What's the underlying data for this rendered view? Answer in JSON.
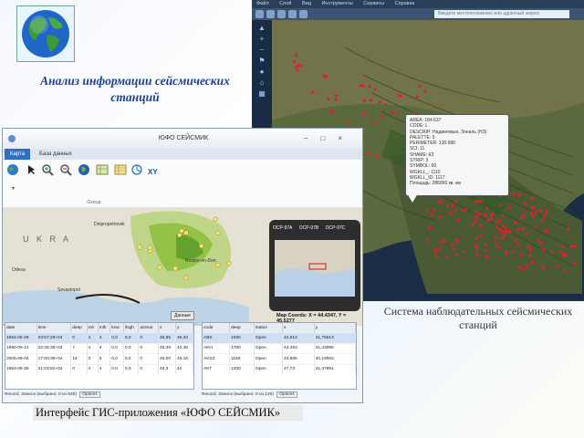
{
  "slide": {
    "title": "Анализ информации сейсмических станций",
    "caption_left": "Интерфейс ГИС-приложения «ЮФО СЕЙСМИК»",
    "caption_right": "Система наблюдательных сейсмических станций"
  },
  "gis": {
    "menu": [
      "Файл",
      "Слой",
      "Вид",
      "Инструменты",
      "Сервисы",
      "Справка"
    ],
    "address_placeholder": "Введите местоположение или адресный запрос",
    "popup": [
      "AREA: 184.637",
      "CODE: L",
      "DESCRIP: Надвиговые, Зональ (НЗ)",
      "PALETTE: 0",
      "PERIMETER: 130.996",
      "SCI: 11",
      "SHAME: КЗ",
      "STRIP: 3",
      "SYMBOL: 60",
      "WGKLL_: 1110",
      "WGKLL_ID: 1117",
      "Площадь: 286000 кв. км"
    ]
  },
  "app": {
    "title": "ЮФО СЕЙСМИК",
    "tabs": [
      "Карта",
      "База данных"
    ],
    "ribbon_group": "Group",
    "ribbon_icons": [
      "globe-icon",
      "cursor-icon",
      "zoom-in-icon",
      "zoom-out-icon",
      "earth-icon",
      "map-layers-icon",
      "table-icon",
      "chart-icon",
      "xy-icon"
    ],
    "inset_legend": [
      "OCP-97A",
      "OCP-97B",
      "OCP-97C"
    ],
    "coords": "Map Coords: X = 44.4347, Y = 45.5277",
    "map_label": "Данные",
    "map_words": [
      "U K R A",
      "Rostov-on-Don",
      "Sevastopol",
      "Dnipropetrovsk",
      "Odesa"
    ],
    "events_table": {
      "columns": [
        "date",
        "time",
        "deep",
        "mh",
        "mlh",
        "kow",
        "ihigh",
        "azimut",
        "x",
        "y"
      ],
      "rows": [
        [
          "1964-06-29",
          "03:57:28+04",
          "0",
          "4",
          "4",
          "0,0",
          "0,0",
          "0",
          "46,95",
          "49,34"
        ],
        [
          "1990-06-21",
          "22:25:35+04",
          "7",
          "4",
          "4",
          "0,0",
          "0,0",
          "0",
          "45,38",
          "42,48"
        ],
        [
          "2005-09-04",
          "17:00:39+04",
          "19",
          "3",
          "5",
          "0,0",
          "0,0",
          "0",
          "45,00",
          "49,16"
        ],
        [
          "1963-05-26",
          "21:03:51+04",
          "0",
          "4",
          "4",
          "0,0",
          "0,0",
          "0",
          "48,3",
          "42"
        ]
      ],
      "footer": "Record:  Записи (выбрано: 0 из 839)",
      "options": "Options"
    },
    "stations_table": {
      "columns": [
        "code",
        "deep",
        "status",
        "x",
        "y"
      ],
      "rows": [
        [
          "ABS",
          "1590",
          "Open",
          "42,813",
          "41,75513"
        ],
        [
          "AKH",
          "1700",
          "Open",
          "43,493",
          "41,43085"
        ],
        [
          "AKSZ",
          "1160",
          "Open",
          "43,885",
          "40,19062"
        ],
        [
          "AKT",
          "1200",
          "Open",
          "47,73",
          "41,47891"
        ]
      ],
      "footer": "Record:  Записи (выбрано: 0 из 126)",
      "options": "Options"
    }
  },
  "colors": {
    "title_blue": "#1c3f95",
    "event_red": "#e0202a",
    "map_green": "#8fbf40"
  }
}
